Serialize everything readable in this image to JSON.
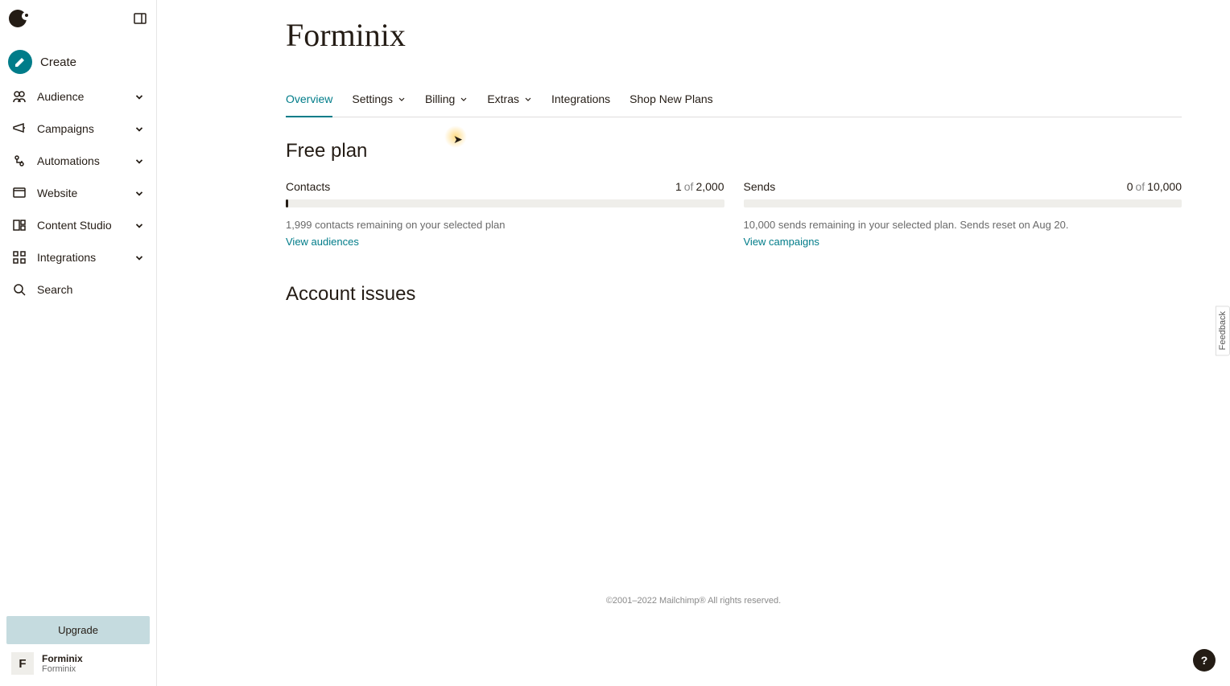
{
  "sidebar": {
    "create_label": "Create",
    "items": [
      {
        "label": "Audience",
        "icon": "audience",
        "expandable": true
      },
      {
        "label": "Campaigns",
        "icon": "campaigns",
        "expandable": true
      },
      {
        "label": "Automations",
        "icon": "automations",
        "expandable": true
      },
      {
        "label": "Website",
        "icon": "website",
        "expandable": true
      },
      {
        "label": "Content Studio",
        "icon": "content",
        "expandable": true
      },
      {
        "label": "Integrations",
        "icon": "integrations",
        "expandable": true
      },
      {
        "label": "Search",
        "icon": "search",
        "expandable": false
      }
    ],
    "upgrade_label": "Upgrade",
    "account": {
      "initial": "F",
      "name": "Forminix",
      "sub": "Forminix"
    }
  },
  "page": {
    "title": "Forminix",
    "tabs": [
      {
        "label": "Overview",
        "dropdown": false,
        "active": true
      },
      {
        "label": "Settings",
        "dropdown": true,
        "active": false
      },
      {
        "label": "Billing",
        "dropdown": true,
        "active": false
      },
      {
        "label": "Extras",
        "dropdown": true,
        "active": false
      },
      {
        "label": "Integrations",
        "dropdown": false,
        "active": false
      },
      {
        "label": "Shop New Plans",
        "dropdown": false,
        "active": false
      }
    ],
    "plan_title": "Free plan",
    "metrics": {
      "contacts": {
        "label": "Contacts",
        "current": "1",
        "of": "of",
        "max": "2,000",
        "caption": "1,999 contacts remaining on your selected plan",
        "link": "View audiences",
        "percent": 0.5
      },
      "sends": {
        "label": "Sends",
        "current": "0",
        "of": "of",
        "max": "10,000",
        "caption": "10,000 sends remaining in your selected plan. Sends reset on Aug 20.",
        "link": "View campaigns",
        "percent": 0
      }
    },
    "account_issues_title": "Account issues"
  },
  "footer": {
    "copyright": "©2001–2022 Mailchimp® All rights reserved."
  },
  "help": {
    "symbol": "?"
  },
  "feedback": {
    "label": "Feedback"
  }
}
